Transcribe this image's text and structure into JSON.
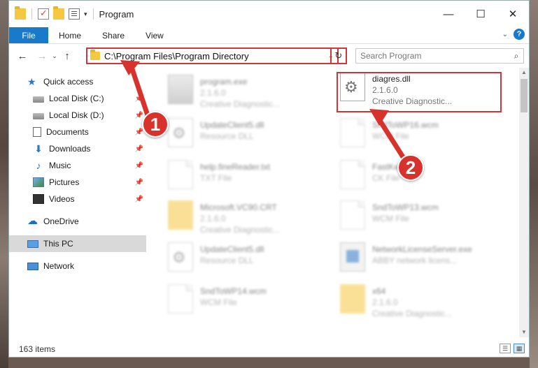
{
  "window": {
    "title": "Program",
    "controls": {
      "minimize": "—",
      "maximize": "☐",
      "close": "✕"
    }
  },
  "ribbon": {
    "tabs": [
      "File",
      "Home",
      "Share",
      "View"
    ]
  },
  "nav": {
    "address": "C:\\Program Files\\Program Directory",
    "search_placeholder": "Search Program"
  },
  "sidebar": {
    "quick_access": "Quick access",
    "items": [
      {
        "label": "Local Disk (C:)",
        "icon": "drive-icon"
      },
      {
        "label": "Local Disk (D:)",
        "icon": "drive-icon"
      },
      {
        "label": "Documents",
        "icon": "documents-icon"
      },
      {
        "label": "Downloads",
        "icon": "downloads-icon"
      },
      {
        "label": "Music",
        "icon": "music-icon"
      },
      {
        "label": "Pictures",
        "icon": "pictures-icon"
      },
      {
        "label": "Videos",
        "icon": "videos-icon"
      }
    ],
    "onedrive": "OneDrive",
    "this_pc": "This PC",
    "network": "Network"
  },
  "files": [
    {
      "name": "program.exe",
      "line2": "2.1.6.0",
      "line3": "Creative Diagnostic...",
      "icon": "exe"
    },
    {
      "name": "diagres.dll",
      "line2": "2.1.6.0",
      "line3": "Creative Diagnostic...",
      "icon": "gear"
    },
    {
      "name": "UpdateClient5.dll",
      "line2": "Resource DLL",
      "icon": "gear"
    },
    {
      "name": "SndToWP16.wcm",
      "line2": "WCM File",
      "icon": "page"
    },
    {
      "name": "help.fineReader.txt",
      "line2": "TXT File",
      "icon": "page"
    },
    {
      "name": "FastKey",
      "line2": "CK File",
      "icon": "page"
    },
    {
      "name": "Microsoft.VC90.CRT",
      "line2": "2.1.6.0",
      "line3": "Creative Diagnostic...",
      "icon": "yfolder"
    },
    {
      "name": "SndToWP13.wcm",
      "line2": "WCM File",
      "icon": "page"
    },
    {
      "name": "UpdateClient5.dll",
      "line2": "Resource DLL",
      "icon": "gear"
    },
    {
      "name": "NetworkLicenseServer.exe",
      "line2": "ABBY network licens...",
      "icon": "netapp"
    },
    {
      "name": "SndToWP14.wcm",
      "line2": "WCM File",
      "icon": "page"
    },
    {
      "name": "x64",
      "line2": "2.1.6.0",
      "line3": "Creative Diagnostic...",
      "icon": "yfolder"
    }
  ],
  "status": {
    "count": "163 items"
  },
  "annotations": {
    "badge1": "1",
    "badge2": "2",
    "color": "#d8322c"
  }
}
